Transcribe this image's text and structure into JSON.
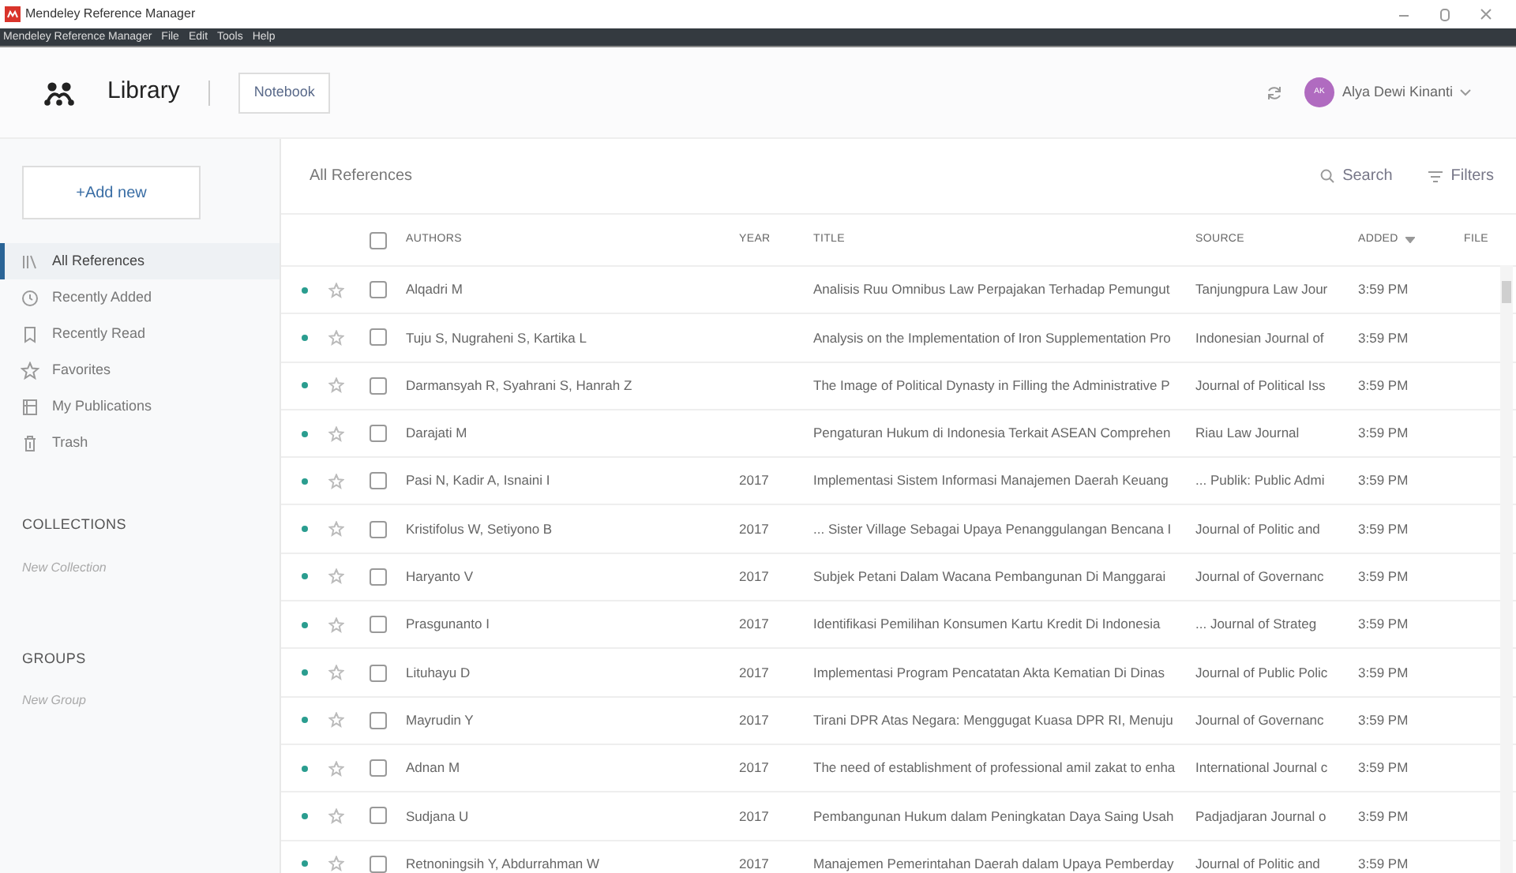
{
  "window": {
    "title": "Mendeley Reference Manager"
  },
  "menu": [
    "Mendeley Reference Manager",
    "File",
    "Edit",
    "Tools",
    "Help"
  ],
  "header": {
    "title": "Library",
    "notebook_button": "Notebook",
    "user": "Alya Dewi Kinanti",
    "avatar_initials": "AK"
  },
  "sidebar": {
    "add_button": "+Add new",
    "items": [
      {
        "label": "All References",
        "selected": true
      },
      {
        "label": "Recently Added",
        "selected": false
      },
      {
        "label": "Recently Read",
        "selected": false
      },
      {
        "label": "Favorites",
        "selected": false
      },
      {
        "label": "My Publications",
        "selected": false
      },
      {
        "label": "Trash",
        "selected": false
      }
    ],
    "collections": {
      "heading": "COLLECTIONS",
      "new_item": "New Collection"
    },
    "groups": {
      "heading": "GROUPS",
      "new_item": "New Group"
    }
  },
  "list": {
    "title": "All References",
    "search": "Search",
    "filters": "Filters"
  },
  "table": {
    "select_all_checked": false,
    "columns": [
      "AUTHORS",
      "YEAR",
      "TITLE",
      "SOURCE",
      "ADDED",
      "FILE"
    ],
    "rows": [
      {
        "unread": true,
        "favorite": false,
        "checked": false,
        "authors": "Alqadri M",
        "year": "",
        "title": "Analisis Ruu Omnibus Law Perpajakan Terhadap Pemungut",
        "source": "Tanjungpura Law Jour",
        "added": "3:59 PM"
      },
      {
        "unread": true,
        "favorite": false,
        "checked": false,
        "authors": "Tuju S, Nugraheni S, Kartika L",
        "year": "",
        "title": "Analysis on the Implementation of Iron Supplementation Pro",
        "source": "Indonesian Journal of",
        "added": "3:59 PM"
      },
      {
        "unread": true,
        "favorite": false,
        "checked": false,
        "authors": "Darmansyah R, Syahrani S, Hanrah Z",
        "year": "",
        "title": "The Image of Political Dynasty in Filling the Administrative P",
        "source": "Journal of Political Iss",
        "added": "3:59 PM"
      },
      {
        "unread": true,
        "favorite": false,
        "checked": false,
        "authors": "Darajati M",
        "year": "",
        "title": "Pengaturan Hukum di Indonesia Terkait ASEAN Comprehen",
        "source": "Riau Law Journal",
        "added": "3:59 PM"
      },
      {
        "unread": true,
        "favorite": false,
        "checked": false,
        "authors": "Pasi N, Kadir A, Isnaini I",
        "year": "2017",
        "title": "Implementasi Sistem Informasi Manajemen Daerah Keuang",
        "source": "... Publik: Public Admi",
        "added": "3:59 PM"
      },
      {
        "unread": true,
        "favorite": false,
        "checked": false,
        "authors": "Kristifolus W, Setiyono B",
        "year": "2017",
        "title": "... Sister Village Sebagai Upaya Penanggulangan Bencana I",
        "source": "Journal of Politic and",
        "added": "3:59 PM"
      },
      {
        "unread": true,
        "favorite": false,
        "checked": false,
        "authors": "Haryanto V",
        "year": "2017",
        "title": "Subjek Petani Dalam Wacana Pembangunan Di Manggarai",
        "source": "Journal of Governanc",
        "added": "3:59 PM"
      },
      {
        "unread": true,
        "favorite": false,
        "checked": false,
        "authors": "Prasgunanto I",
        "year": "2017",
        "title": "Identifikasi Pemilihan Konsumen Kartu Kredit Di Indonesia",
        "source": "... Journal of Strateg",
        "added": "3:59 PM"
      },
      {
        "unread": true,
        "favorite": false,
        "checked": false,
        "authors": "Lituhayu D",
        "year": "2017",
        "title": "Implementasi Program Pencatatan Akta Kematian Di Dinas",
        "source": "Journal of Public Polic",
        "added": "3:59 PM"
      },
      {
        "unread": true,
        "favorite": false,
        "checked": false,
        "authors": "Mayrudin Y",
        "year": "2017",
        "title": "Tirani DPR Atas Negara: Menggugat Kuasa DPR RI, Menuju",
        "source": "Journal of Governanc",
        "added": "3:59 PM"
      },
      {
        "unread": true,
        "favorite": false,
        "checked": false,
        "authors": "Adnan M",
        "year": "2017",
        "title": "The need of establishment of professional amil zakat to enha",
        "source": "International Journal c",
        "added": "3:59 PM"
      },
      {
        "unread": true,
        "favorite": false,
        "checked": false,
        "authors": "Sudjana U",
        "year": "2017",
        "title": "Pembangunan Hukum dalam Peningkatan Daya Saing Usah",
        "source": "Padjadjaran Journal o",
        "added": "3:59 PM"
      },
      {
        "unread": true,
        "favorite": false,
        "checked": false,
        "authors": "Retnoningsih Y, Abdurrahman W",
        "year": "2017",
        "title": "Manajemen Pemerintahan Daerah dalam Upaya Pemberday",
        "source": "Journal of Politic and",
        "added": "3:59 PM"
      }
    ]
  }
}
